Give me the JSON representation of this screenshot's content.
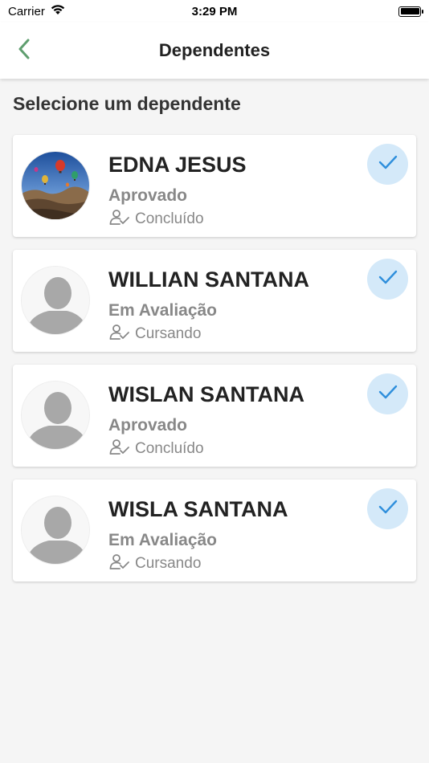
{
  "status_bar": {
    "carrier": "Carrier",
    "time": "3:29 PM"
  },
  "header": {
    "title": "Dependentes"
  },
  "section_title": "Selecione um dependente",
  "colors": {
    "nav_accent": "#5f9e6f",
    "check_bg": "#d4e9f9",
    "check_icon": "#2f8fdc",
    "status_text": "#888888"
  },
  "dependents": [
    {
      "name": "EDNA JESUS",
      "status": "Aprovado",
      "course_status": "Concluído",
      "avatar": "photo-hot-air-balloons",
      "selected": true
    },
    {
      "name": "WILLIAN SANTANA",
      "status": "Em Avaliação",
      "course_status": "Cursando",
      "avatar": "placeholder-silhouette",
      "selected": true
    },
    {
      "name": "WISLAN SANTANA",
      "status": "Aprovado",
      "course_status": "Concluído",
      "avatar": "placeholder-silhouette",
      "selected": true
    },
    {
      "name": "WISLA SANTANA",
      "status": "Em Avaliação",
      "course_status": "Cursando",
      "avatar": "placeholder-silhouette",
      "selected": true
    }
  ]
}
